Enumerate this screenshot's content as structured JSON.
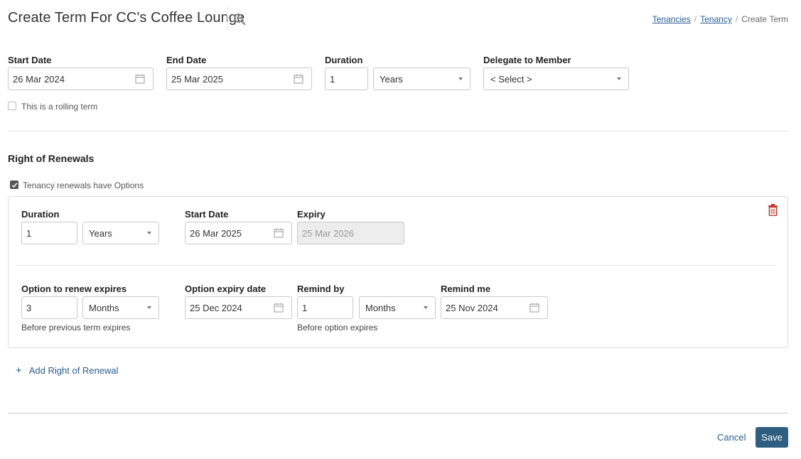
{
  "header": {
    "title": "Create Term For CC's Coffee Lounge",
    "breadcrumb": [
      "Tenancies",
      "Tenancy",
      "Create Term"
    ],
    "breadcrumb_sep": "/"
  },
  "term": {
    "start_date_label": "Start Date",
    "start_date": "26 Mar 2024",
    "end_date_label": "End Date",
    "end_date": "25 Mar 2025",
    "duration_label": "Duration",
    "duration_value": "1",
    "duration_unit": "Years",
    "delegate_label": "Delegate to Member",
    "delegate_value": "< Select >",
    "rolling_label": "This is a rolling term",
    "rolling_checked": false
  },
  "renewals": {
    "section_title": "Right of Renewals",
    "has_options_label": "Tenancy renewals have Options",
    "has_options_checked": true,
    "option": {
      "duration_label": "Duration",
      "duration_value": "1",
      "duration_unit": "Years",
      "start_date_label": "Start Date",
      "start_date": "26 Mar 2025",
      "expiry_label": "Expiry",
      "expiry": "25 Mar 2026",
      "option_expires_label": "Option to renew expires",
      "option_expires_value": "3",
      "option_expires_unit": "Months",
      "option_expires_hint": "Before previous term expires",
      "option_expiry_date_label": "Option expiry date",
      "option_expiry_date": "25 Dec 2024",
      "remind_by_label": "Remind by",
      "remind_by_value": "1",
      "remind_by_unit": "Months",
      "remind_by_hint": "Before option expires",
      "remind_me_label": "Remind me",
      "remind_me_date": "25 Nov 2024"
    },
    "add_label": "Add Right of Renewal",
    "add_icon": "+"
  },
  "footer": {
    "cancel_label": "Cancel",
    "save_label": "Save"
  },
  "colors": {
    "accent": "#2f5f80",
    "link": "#2a5d8f",
    "delete": "#c0392b"
  }
}
